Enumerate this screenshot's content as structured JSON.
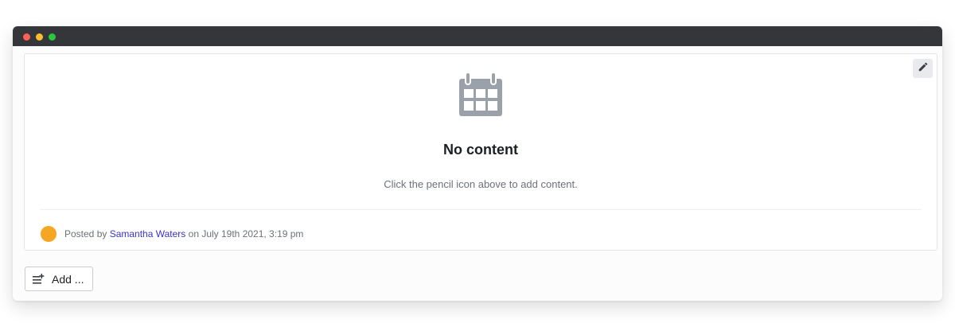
{
  "window": {
    "controls": [
      "close",
      "minimize",
      "maximize"
    ]
  },
  "card": {
    "edit_icon": "pencil-icon",
    "empty_icon": "calendar-icon",
    "empty_title": "No content",
    "empty_description": "Click the pencil icon above to add content.",
    "meta": {
      "posted_by": "Posted by ",
      "author": "Samantha Waters",
      "date_text": " on July 19th 2021, 3:19 pm"
    }
  },
  "add_button": {
    "icon": "add-list-icon",
    "label": "Add ..."
  },
  "colors": {
    "titlebar": "#343639",
    "link": "#3a32c8",
    "icon_gray": "#9aa1aa"
  }
}
